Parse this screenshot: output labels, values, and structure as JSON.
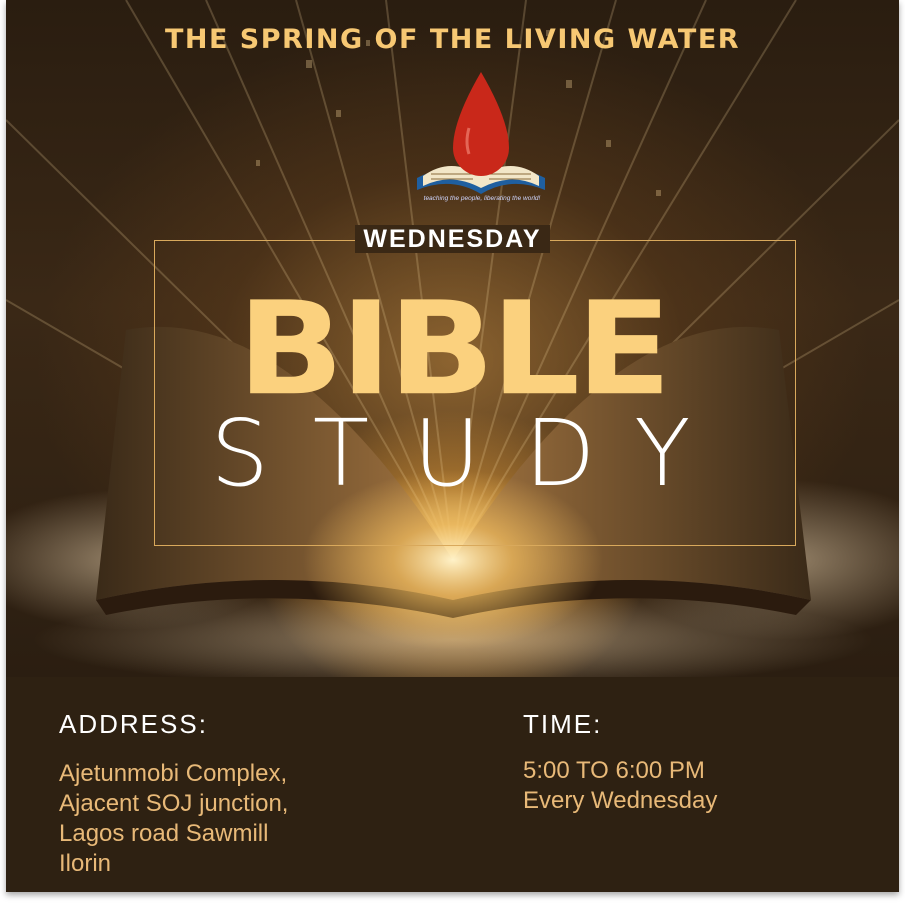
{
  "header": {
    "title": "THE SPRING OF THE LIVING WATER",
    "logo_tagline": "teaching the people, liberating the world!"
  },
  "main": {
    "day": "WEDNESDAY",
    "title_line1": "BIBLE",
    "title_line2": "STUDY"
  },
  "info": {
    "address_label": "ADDRESS:",
    "address_lines": [
      "Ajetunmobi Complex,",
      "Ajacent SOJ junction,",
      "Lagos road Sawmill",
      "Ilorin"
    ],
    "time_label": "TIME:",
    "time_lines": [
      "5:00 TO 6:00 PM",
      "Every Wednesday"
    ]
  },
  "colors": {
    "gold": "#fbd17e",
    "title_gold": "#f7c873",
    "panel_bg": "#2e2112",
    "info_text": "#e8b978",
    "drop_red": "#c9281a"
  },
  "icons": [
    "water-drop-icon",
    "open-book-icon"
  ]
}
